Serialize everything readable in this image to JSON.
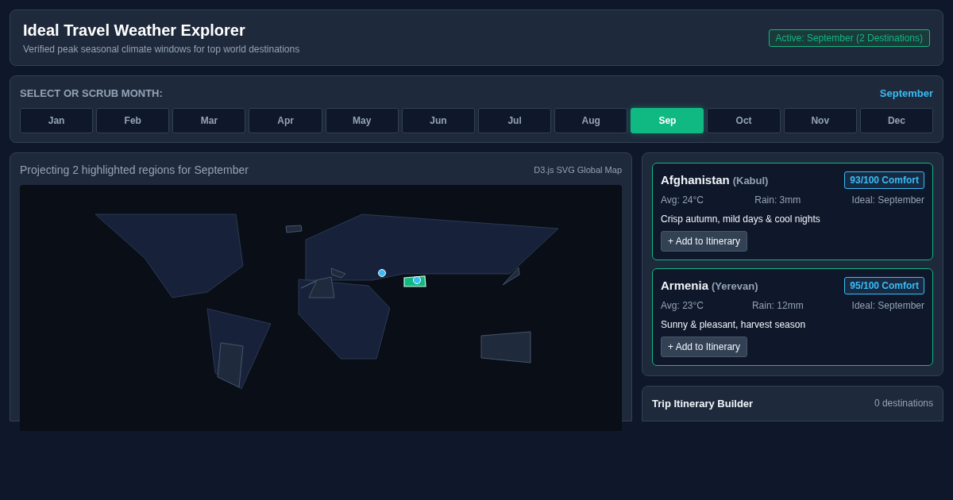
{
  "header": {
    "title": "Ideal Travel Weather Explorer",
    "subtitle": "Verified peak seasonal climate windows for top world destinations",
    "status_badge": "Active: September (2 Destinations)"
  },
  "month_picker": {
    "label": "SELECT OR SCRUB MONTH:",
    "current": "September",
    "months": [
      {
        "label": "Jan",
        "selected": false
      },
      {
        "label": "Feb",
        "selected": false
      },
      {
        "label": "Mar",
        "selected": false
      },
      {
        "label": "Apr",
        "selected": false
      },
      {
        "label": "May",
        "selected": false
      },
      {
        "label": "Jun",
        "selected": false
      },
      {
        "label": "Jul",
        "selected": false
      },
      {
        "label": "Aug",
        "selected": false
      },
      {
        "label": "Sep",
        "selected": true
      },
      {
        "label": "Oct",
        "selected": false
      },
      {
        "label": "Nov",
        "selected": false
      },
      {
        "label": "Dec",
        "selected": false
      }
    ]
  },
  "map": {
    "caption": "Projecting 2 highlighted regions for September",
    "source": "D3.js SVG Global Map"
  },
  "destinations": [
    {
      "country": "Afghanistan",
      "city": "(Kabul)",
      "score": "93/100 Comfort",
      "avg": "Avg: 24°C",
      "rain": "Rain: 3mm",
      "ideal": "Ideal: September",
      "description": "Crisp autumn, mild days & cool nights",
      "button": "+ Add to Itinerary"
    },
    {
      "country": "Armenia",
      "city": "(Yerevan)",
      "score": "95/100 Comfort",
      "avg": "Avg: 23°C",
      "rain": "Rain: 12mm",
      "ideal": "Ideal: September",
      "description": "Sunny & pleasant, harvest season",
      "button": "+ Add to Itinerary"
    }
  ],
  "itinerary": {
    "title": "Trip Itinerary Builder",
    "count": "0 destinations"
  }
}
